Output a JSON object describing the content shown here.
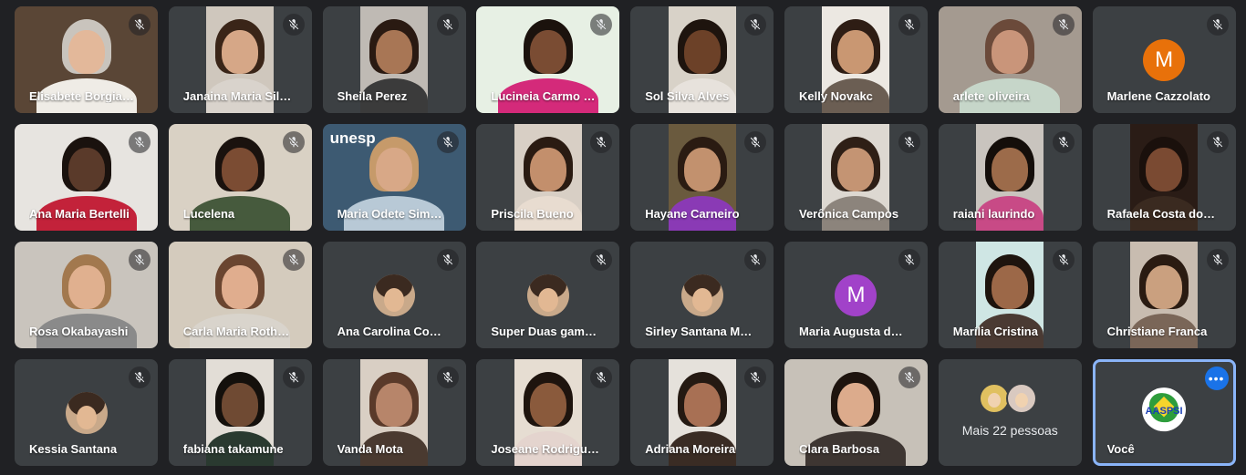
{
  "participants": [
    {
      "name": "Elisabete Borgia…",
      "kind": "video",
      "bg": "#5a4636",
      "skin": "#e3b89a",
      "hair": "#c9c4bd",
      "shirt": "#efece6",
      "full": true
    },
    {
      "name": "Janaina Maria Sil…",
      "kind": "video",
      "bg": "#cfc7bd",
      "skin": "#d6a787",
      "hair": "#3a2518",
      "shirt": "#d9d3cc"
    },
    {
      "name": "Sheila Perez",
      "kind": "video",
      "bg": "#bfbab4",
      "skin": "#a87655",
      "hair": "#2a1a12",
      "shirt": "#3b3b3b"
    },
    {
      "name": "Lucineia Carmo …",
      "kind": "video",
      "bg": "#e7f0e4",
      "skin": "#7a4c33",
      "hair": "#1b120d",
      "shirt": "#d42a7a",
      "full": true
    },
    {
      "name": "Sol Silva Alves",
      "kind": "video",
      "bg": "#d8d2c8",
      "skin": "#6c4128",
      "hair": "#1e140e",
      "shirt": "#e7e2dc"
    },
    {
      "name": "Kelly Novakc",
      "kind": "video",
      "bg": "#ece8e2",
      "skin": "#c99772",
      "hair": "#2e1d14",
      "shirt": "#6b5e53"
    },
    {
      "name": "arlete oliveira",
      "kind": "video",
      "bg": "#a49a90",
      "skin": "#c9957a",
      "hair": "#6b4a3a",
      "shirt": "#c6d6c9",
      "full": true
    },
    {
      "name": "Marlene Cazzolato",
      "kind": "letter",
      "letter": "M",
      "color": "#e8710a"
    },
    {
      "name": "Ana Maria Bertelli",
      "kind": "video",
      "bg": "#e7e4e0",
      "skin": "#5a3a2a",
      "hair": "#1a120e",
      "shirt": "#c3223a",
      "full": true
    },
    {
      "name": "Lucelena",
      "kind": "video",
      "bg": "#d9d1c4",
      "skin": "#7b4c33",
      "hair": "#1a120e",
      "shirt": "#465a3d",
      "full": true
    },
    {
      "name": "Maria Odete Sim…",
      "kind": "video",
      "bg": "#3d5a72",
      "skin": "#d8a887",
      "hair": "#c69a6a",
      "shirt": "#b8c9d6",
      "full": true,
      "sign": "unesp"
    },
    {
      "name": "Priscila Bueno",
      "kind": "video",
      "bg": "#d8cfc5",
      "skin": "#c38f6c",
      "hair": "#2a1b12",
      "shirt": "#e8dcd0"
    },
    {
      "name": "Hayane Carneiro",
      "kind": "video",
      "bg": "#6a5a3e",
      "skin": "#c2916e",
      "hair": "#2a1b12",
      "shirt": "#8a3ab5"
    },
    {
      "name": "Verônica Campos",
      "kind": "video",
      "bg": "#ddd8d1",
      "skin": "#c49473",
      "hair": "#2e1f16",
      "shirt": "#8c847c"
    },
    {
      "name": "raiani laurindo",
      "kind": "video",
      "bg": "#c9c4be",
      "skin": "#9c6b4a",
      "hair": "#140e0a",
      "shirt": "#c84a86"
    },
    {
      "name": "Rafaela Costa do…",
      "kind": "video",
      "bg": "#2a1c16",
      "skin": "#7a4a32",
      "hair": "#1a100c",
      "shirt": "#3a2a20"
    },
    {
      "name": "Rosa Okabayashi",
      "kind": "video",
      "bg": "#c9c4bd",
      "skin": "#e0b08f",
      "hair": "#a2784e",
      "shirt": "#8a8a8a",
      "full": true
    },
    {
      "name": "Carla Maria Roth…",
      "kind": "video",
      "bg": "#d4cbbd",
      "skin": "#e0ad8e",
      "hair": "#6a4530",
      "shirt": "#d9d4cc",
      "full": true
    },
    {
      "name": "Ana Carolina Co…",
      "kind": "photo"
    },
    {
      "name": "Super Duas gam…",
      "kind": "photo"
    },
    {
      "name": "Sirley Santana M…",
      "kind": "photo"
    },
    {
      "name": "Maria Augusta d…",
      "kind": "letter",
      "letter": "M",
      "color": "#a142c9"
    },
    {
      "name": "Marília Cristina",
      "kind": "video",
      "bg": "#cfe6e4",
      "skin": "#9c6848",
      "hair": "#1e140e",
      "shirt": "#4a3a33"
    },
    {
      "name": "Christiane Franca",
      "kind": "video",
      "bg": "#c8bcb0",
      "skin": "#caa07f",
      "hair": "#2a1b12",
      "shirt": "#7a6658"
    },
    {
      "name": "Kessia Santana",
      "kind": "photo"
    },
    {
      "name": "fabiana takamune",
      "kind": "video",
      "bg": "#e2ddd6",
      "skin": "#6f4a33",
      "hair": "#14100c",
      "shirt": "#2a3a30"
    },
    {
      "name": "Vanda Mota",
      "kind": "video",
      "bg": "#d9cfc4",
      "skin": "#b7856a",
      "hair": "#5a3a2a",
      "shirt": "#4a3a30"
    },
    {
      "name": "Joseane Rodrigu…",
      "kind": "video",
      "bg": "#e6ddd2",
      "skin": "#8a5a3c",
      "hair": "#1e140e",
      "shirt": "#e4d4ce"
    },
    {
      "name": "Adriana Moreira",
      "kind": "video",
      "bg": "#e5e1db",
      "skin": "#a87054",
      "hair": "#241912",
      "shirt": "#3a2c24"
    },
    {
      "name": "Clara Barbosa",
      "kind": "video",
      "bg": "#c7c1b8",
      "skin": "#dcab8c",
      "hair": "#1e140e",
      "shirt": "#3e3632",
      "full": true
    },
    {
      "name": "",
      "kind": "more",
      "more_text": "Mais 22 pessoas"
    },
    {
      "name": "Você",
      "kind": "self",
      "logo_text": "AASPSI"
    }
  ],
  "colors": {
    "background": "#202124",
    "tile": "#3c4043",
    "self_border": "#8ab4f8",
    "menu_button": "#1a73e8"
  },
  "icons": {
    "mic_muted": "mic-off-icon",
    "menu": "more-options-icon"
  }
}
